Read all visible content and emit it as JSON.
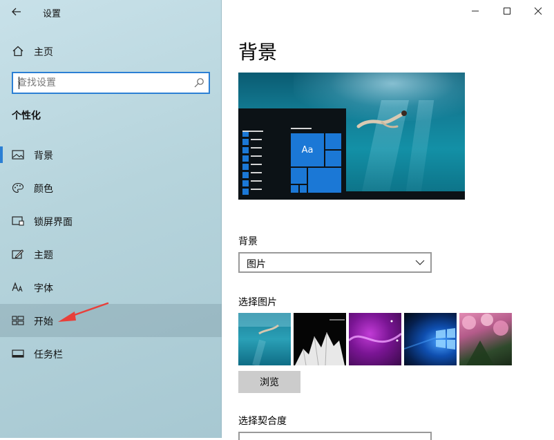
{
  "app": {
    "title": "设置"
  },
  "sidebar": {
    "home_label": "主页",
    "search": {
      "placeholder": "查找设置"
    },
    "section_title": "个性化",
    "items": [
      {
        "label": "背景",
        "icon": "image-icon",
        "active": true
      },
      {
        "label": "颜色",
        "icon": "palette-icon",
        "active": false
      },
      {
        "label": "锁屏界面",
        "icon": "lock-screen-icon",
        "active": false
      },
      {
        "label": "主题",
        "icon": "theme-icon",
        "active": false
      },
      {
        "label": "字体",
        "icon": "font-icon",
        "active": false
      },
      {
        "label": "开始",
        "icon": "start-icon",
        "active": false,
        "hovered": true
      },
      {
        "label": "任务栏",
        "icon": "taskbar-icon",
        "active": false
      }
    ]
  },
  "main": {
    "page_title": "背景",
    "preview": {
      "tile_label": "Aa"
    },
    "background": {
      "label": "背景",
      "value": "图片"
    },
    "choose_picture": {
      "label": "选择图片"
    },
    "browse_label": "浏览",
    "fit": {
      "label": "选择契合度"
    }
  },
  "colors": {
    "accent": "#2b7fd4",
    "annotation_arrow": "#e8403a",
    "tile_blue": "#1b78d6"
  }
}
